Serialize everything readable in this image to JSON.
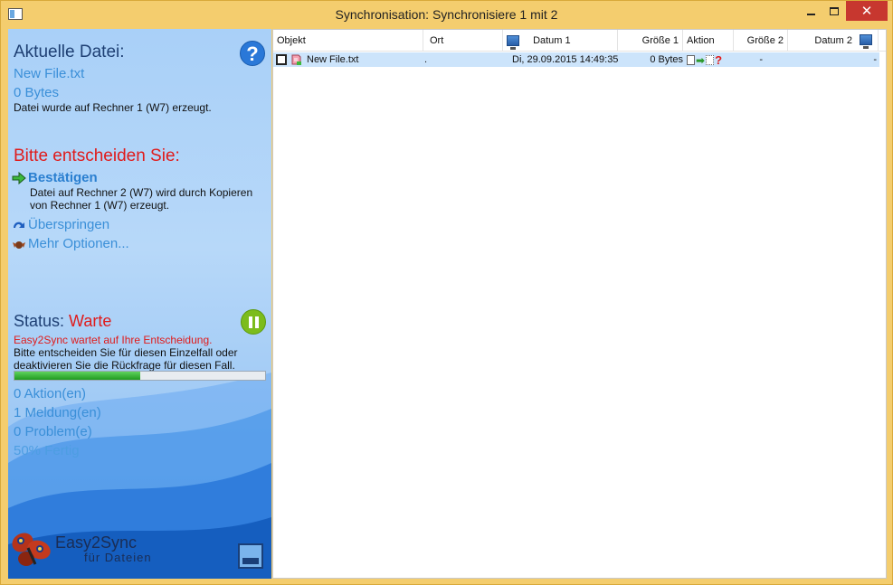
{
  "window": {
    "title": "Synchronisation: Synchronisiere 1 mit 2",
    "controls": {
      "minimize": "",
      "maximize": "",
      "close": "✕"
    }
  },
  "left": {
    "current_file_heading": "Aktuelle Datei:",
    "file_name": "New File.txt",
    "file_size": "0 Bytes",
    "file_desc": "Datei wurde auf Rechner 1 (W7) erzeugt.",
    "help_icon": "?",
    "decide_heading": "Bitte entscheiden Sie:",
    "options": {
      "confirm": "Bestätigen",
      "confirm_desc": "Datei auf Rechner 2 (W7) wird durch Kopieren von Rechner 1 (W7) erzeugt.",
      "skip": "Überspringen",
      "more": "Mehr Optionen..."
    },
    "status_label": "Status:",
    "status_value": "Warte",
    "wait_msg": "Easy2Sync wartet auf Ihre Entscheidung.",
    "hint_msg": "Bitte entscheiden Sie für diesen Einzelfall oder deaktivieren Sie die Rückfrage für diesen Fall.",
    "progress": 0.5,
    "stats": {
      "actions": "0 Aktion(en)",
      "messages": "1 Meldung(en)",
      "problems": "0 Problem(e)",
      "done": "50% Fertig"
    },
    "brand": "Easy2Sync",
    "brand_sub": "für Dateien"
  },
  "list": {
    "columns": {
      "object": "Objekt",
      "location": "Ort",
      "date1": "Datum 1",
      "size1": "Größe 1",
      "action": "Aktion",
      "size2": "Größe 2",
      "date2": "Datum 2"
    },
    "rows": [
      {
        "object": "New File.txt",
        "location": ".",
        "date1": "Di, 29.09.2015 14:49:35",
        "size1": "0 Bytes",
        "size2": "-",
        "date2": "-"
      }
    ]
  },
  "icons": {
    "app": "window-icon",
    "help": "question-icon",
    "confirm": "arrow-right-icon",
    "skip": "curved-arrow-icon",
    "more": "options-icon",
    "pause": "pause-icon",
    "computer": "computer-icon",
    "collapse": "collapse-icon",
    "logo": "butterfly-icon"
  },
  "colors": {
    "title_bar": "#f4cd6e",
    "close_button": "#c7372f",
    "heading_red": "#e01b1b",
    "heading_blue": "#1e3f73",
    "link_blue": "#3a8fd8",
    "progress_green": "#1f9a1f",
    "row_selected": "#cce4fb"
  }
}
